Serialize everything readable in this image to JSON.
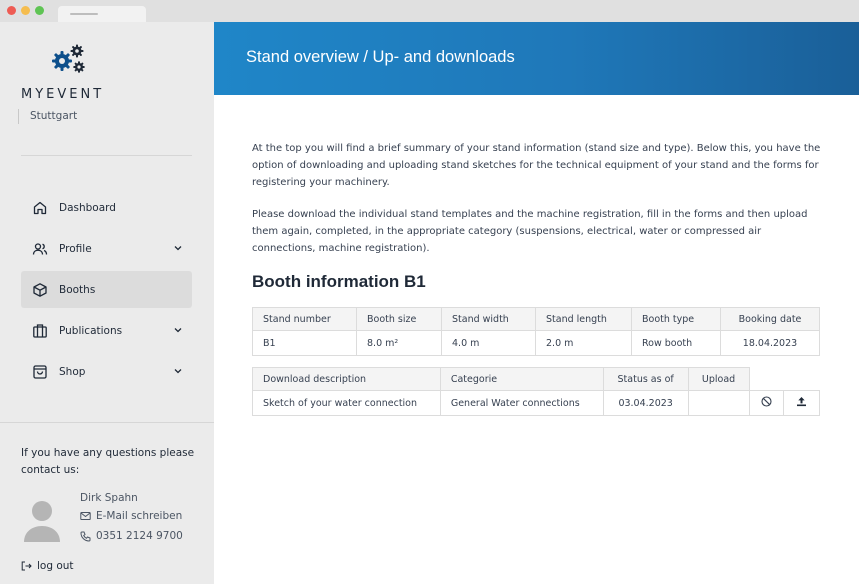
{
  "sidebar": {
    "brand": "MYEVENT",
    "location": "Stuttgart",
    "nav": [
      {
        "label": "Dashboard",
        "icon": "home-icon"
      },
      {
        "label": "Profile",
        "icon": "users-icon"
      },
      {
        "label": "Booths",
        "icon": "box-icon"
      },
      {
        "label": "Publications",
        "icon": "columns-icon"
      },
      {
        "label": "Shop",
        "icon": "shopping-bag-icon"
      }
    ],
    "contact_text": "If you have any questions please contact us:",
    "contact_name": "Dirk Spahn",
    "contact_email": "E-Mail schreiben",
    "contact_phone": "0351 2124 9700",
    "logout": "log out"
  },
  "header": {
    "title": "Stand overview / Up- and downloads"
  },
  "main": {
    "intro1": "At the top you will find a brief summary of your stand information (stand size and type). Below this, you have the option of downloading and uploading stand sketches for the technical equipment of your stand and the forms for registering your machinery.",
    "intro2": "Please download the individual stand templates and the machine registration, fill in the forms and then upload them again, completed, in the appropriate category (suspensions, electrical, water or compressed air connections, machine registration).",
    "booth_title": "Booth information B1",
    "booth_table": {
      "headers": [
        "Stand number",
        "Booth size",
        "Stand width",
        "Stand length",
        "Booth type",
        "Booking date"
      ],
      "row": [
        "B1",
        "8.0 m²",
        "4.0 m",
        "2.0 m",
        "Row booth",
        "18.04.2023"
      ]
    },
    "download_table": {
      "headers": [
        "Download description",
        "Categorie",
        "Status as of",
        "Upload"
      ],
      "row": [
        "Sketch of your water connection",
        "General Water connections",
        "03.04.2023",
        ""
      ]
    }
  },
  "colors": {
    "header_start": "#1f86c8",
    "header_end": "#1a5f98",
    "sidebar_bg": "#ebebeb",
    "active_item_bg": "#dcdcdc"
  }
}
